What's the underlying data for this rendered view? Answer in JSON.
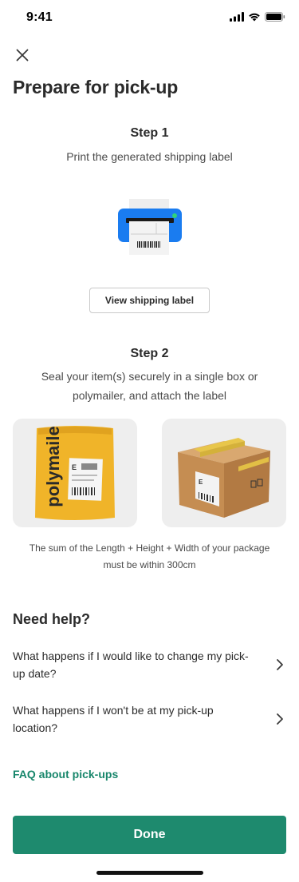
{
  "status_bar": {
    "time": "9:41"
  },
  "header": {
    "title": "Prepare for pick-up"
  },
  "step1": {
    "title": "Step 1",
    "description": "Print the generated shipping label",
    "button_label": "View shipping label"
  },
  "step2": {
    "title": "Step 2",
    "description": "Seal your item(s) securely in a single box or polymailer, and attach the label",
    "polymailer_text": "polymaile",
    "label_letter": "E",
    "note": "The sum of the Length + Height + Width of your package must be within 300cm"
  },
  "help": {
    "title": "Need help?",
    "items": [
      {
        "label": "What happens if I would like to change my pick-up date?"
      },
      {
        "label": "What happens if I won't be at my pick-up location?"
      }
    ],
    "faq_link": "FAQ about pick-ups"
  },
  "footer": {
    "done_label": "Done"
  },
  "colors": {
    "accent": "#1e8a6e",
    "link": "#17866b",
    "printer_blue": "#1a7cf0"
  }
}
